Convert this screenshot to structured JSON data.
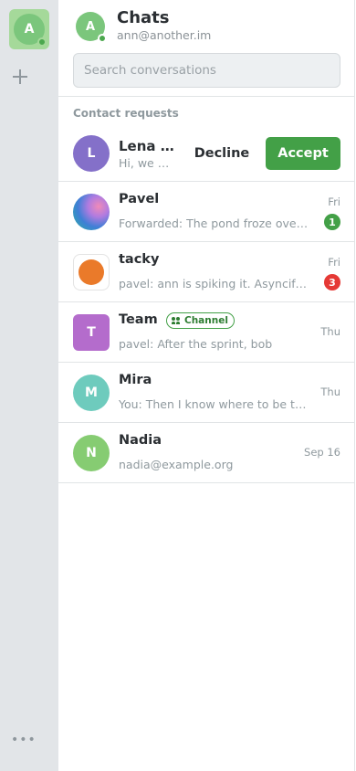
{
  "account": {
    "initial": "A",
    "title": "Chats",
    "email": "ann@another.im",
    "color": "#7bc67c",
    "online_color": "#4ca84e"
  },
  "rail": {
    "add_icon": "plus-icon",
    "more_label": "•••"
  },
  "search": {
    "placeholder": "Search conversations"
  },
  "contact_requests": {
    "label": "Contact requests",
    "items": [
      {
        "initial": "L",
        "name": "Lena Kowalski",
        "preview": "Hi, we met at the meetup",
        "color": "#8470c9",
        "decline_label": "Decline",
        "accept_label": "Accept",
        "accept_color": "#43a047"
      }
    ]
  },
  "chats": [
    {
      "name": "Pavel",
      "preview": "Forwarded: The pond froze over last night",
      "time": "Fri",
      "unread": "1",
      "badge_color": "#43a047",
      "avatar": "gradient-photo"
    },
    {
      "name": "tacky",
      "preview": "pavel: ann is spiking it. Asyncify it",
      "time": "Fri",
      "unread": "3",
      "badge_color": "#e53935",
      "avatar_color": "#ea7a2a"
    },
    {
      "initial": "T",
      "name": "Team",
      "tag": "Channel",
      "tag_icon": "people-icon",
      "preview": "pavel: After the sprint, bob",
      "time": "Thu",
      "color": "#b46ccc"
    },
    {
      "initial": "M",
      "name": "Mira",
      "preview": "You: Then I know where to be tomorrow",
      "time": "Thu",
      "color": "#6ecbbd"
    },
    {
      "initial": "N",
      "name": "Nadia",
      "preview": "nadia@example.org",
      "time": "Sep 16",
      "color": "#86cc72"
    }
  ]
}
